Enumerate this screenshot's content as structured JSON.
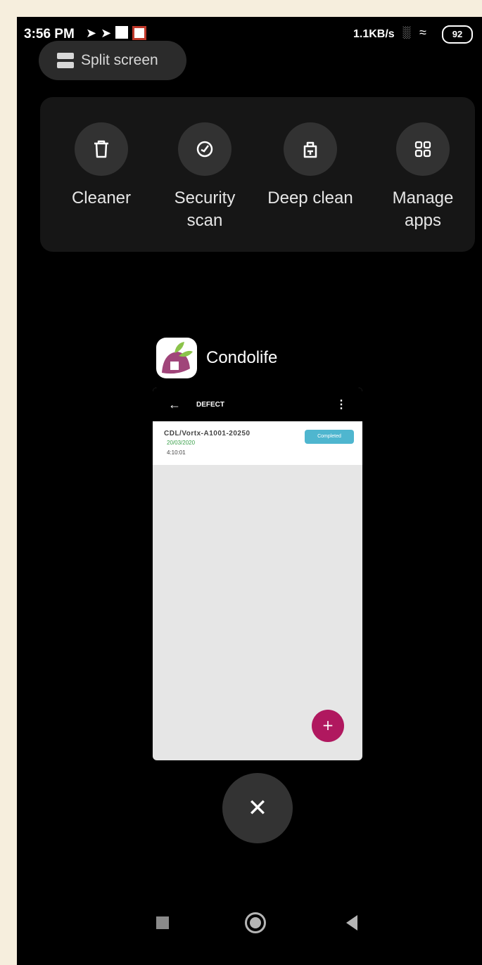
{
  "status_bar": {
    "time": "3:56 PM",
    "net_speed": "1.1KB/s",
    "battery": "92"
  },
  "split_screen": {
    "label": "Split screen"
  },
  "tools": [
    {
      "label": "Cleaner",
      "icon": "trash-icon"
    },
    {
      "label": "Security scan",
      "icon": "shield-check-icon"
    },
    {
      "label": "Deep clean",
      "icon": "deep-clean-icon"
    },
    {
      "label": "Manage apps",
      "icon": "apps-grid-icon"
    }
  ],
  "recent_app": {
    "name": "Condolife",
    "preview": {
      "title": "DEFECT",
      "reference": "CDL/Vortx-A1001-20250",
      "date": "20/03/2020",
      "time": "4:10:01",
      "status_badge": "Completed"
    }
  },
  "colors": {
    "background": "#000000",
    "tile": "#323232",
    "fab": "#b0185f",
    "badge": "#4fb6cf"
  }
}
